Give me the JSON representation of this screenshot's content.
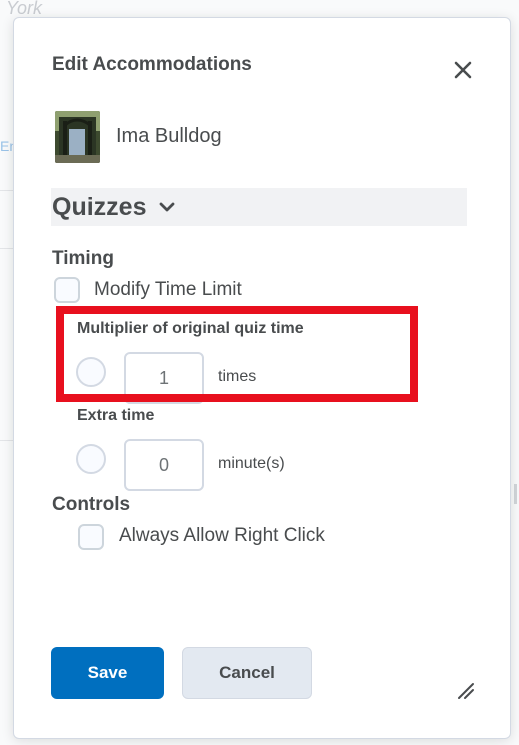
{
  "background": {
    "partial_text_top": "York",
    "partial_text_left": "En"
  },
  "dialog": {
    "title": "Edit Accommodations",
    "user": {
      "name": "Ima Bulldog"
    },
    "section": {
      "title": "Quizzes"
    },
    "timing": {
      "label": "Timing",
      "modify_time_limit_label": "Modify Time Limit",
      "multiplier": {
        "label": "Multiplier of original quiz time",
        "value": "1",
        "unit": "times"
      },
      "extra_time": {
        "label": "Extra time",
        "value": "0",
        "unit": "minute(s)"
      }
    },
    "controls": {
      "label": "Controls",
      "right_click_label": "Always Allow Right Click"
    },
    "buttons": {
      "save": "Save",
      "cancel": "Cancel"
    }
  },
  "colors": {
    "primary": "#006fbf",
    "highlight": "#e8101e",
    "text": "#494c4e"
  },
  "icons": {
    "close": "close-icon",
    "chevron": "chevron-down-icon",
    "resize": "resize-grip-icon"
  }
}
